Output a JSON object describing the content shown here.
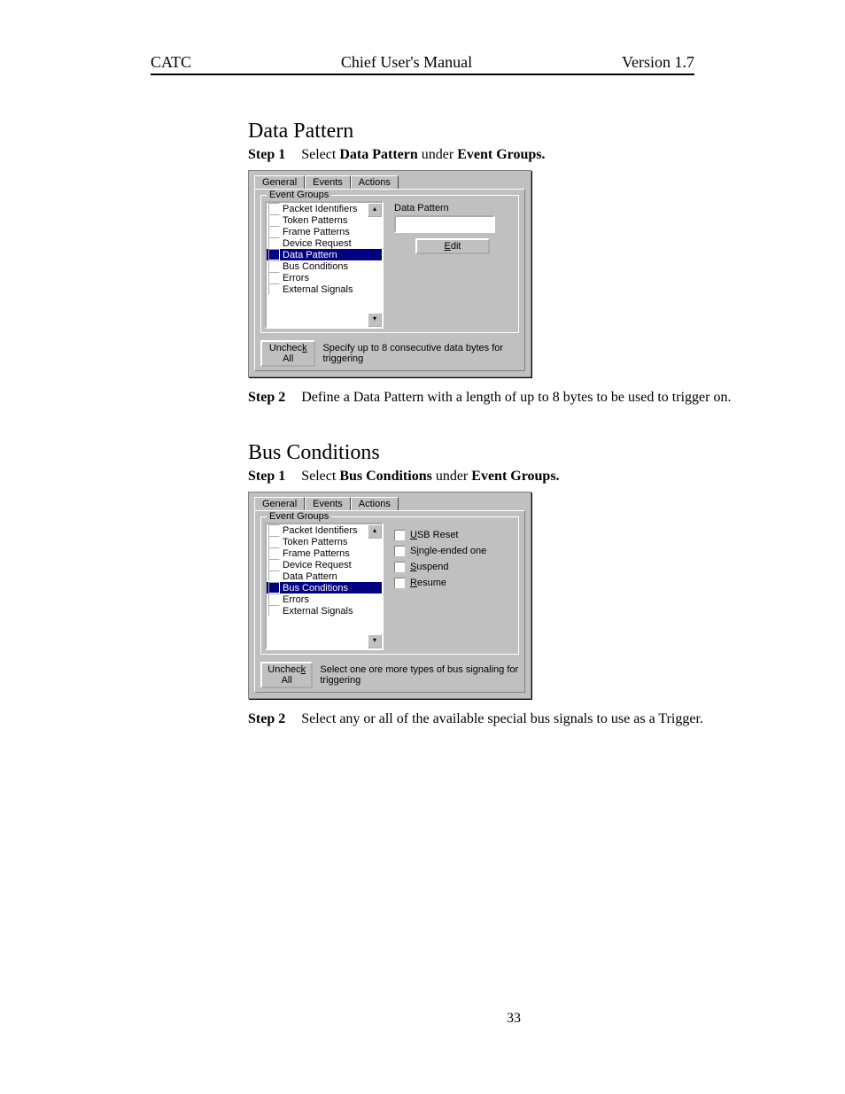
{
  "header": {
    "left": "CATC",
    "center": "Chief User's Manual",
    "right": "Version 1.7"
  },
  "section1": {
    "title": "Data Pattern",
    "step1": {
      "label": "Step 1",
      "pre": "Select ",
      "b1": "Data Pattern",
      "mid": " under ",
      "b2": "Event Groups."
    },
    "step2": {
      "label": "Step 2",
      "text": "Define a Data Pattern with a length of up to 8 bytes to be used to trigger on."
    }
  },
  "section2": {
    "title": "Bus Conditions",
    "step1": {
      "label": "Step 1",
      "pre": "Select ",
      "b1": "Bus Conditions",
      "mid": " under ",
      "b2": "Event Groups."
    },
    "step2": {
      "label": "Step 2",
      "text": "Select any or all of the available special bus signals to use as a Trigger."
    }
  },
  "dialog": {
    "tabs": {
      "general": "General",
      "events": "Events",
      "actions": "Actions"
    },
    "groupLegend": "Event Groups",
    "items": {
      "pi": "Packet Identifiers",
      "tp": "Token Patterns",
      "fp": "Frame Patterns",
      "dr": "Device Request",
      "dp": "Data Pattern",
      "bc": "Bus Conditions",
      "er": "Errors",
      "es": "External Signals"
    },
    "uncheckAll": "Uncheck All",
    "hint1": "Specify up to 8 consecutive data bytes for triggering",
    "hint2": "Select one ore more types of bus signaling for triggering",
    "dpLabel": "Data Pattern",
    "editBtn": "Edit",
    "bcOpts": {
      "usb": "USB Reset",
      "se": "Single-ended one",
      "sus": "Suspend",
      "res": "Resume"
    }
  },
  "pageNumber": "33"
}
